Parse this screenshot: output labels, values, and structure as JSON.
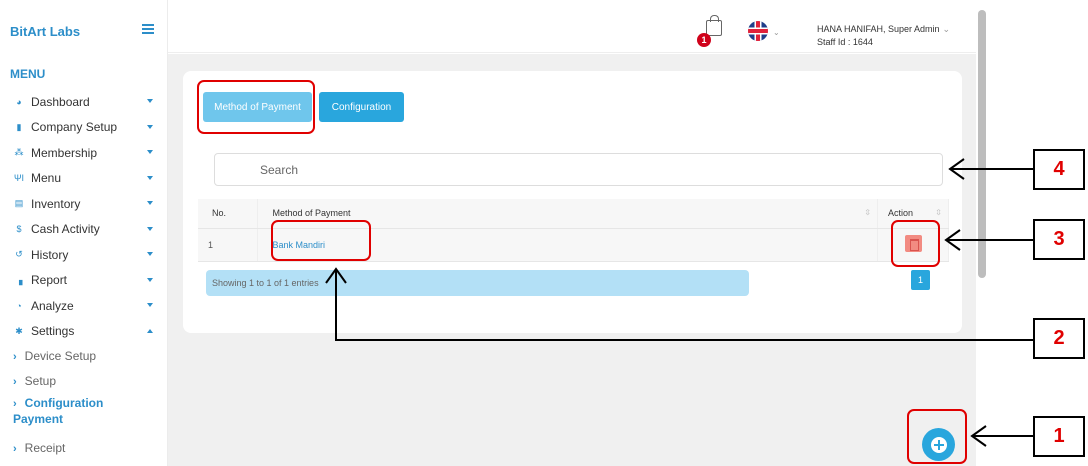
{
  "sidebar": {
    "brand": "BitArt Labs",
    "menu_title": "MENU",
    "items": [
      {
        "label": "Dashboard",
        "icon": "dashboard-icon",
        "glyph": "◕"
      },
      {
        "label": "Company Setup",
        "icon": "building-icon",
        "glyph": "▮"
      },
      {
        "label": "Membership",
        "icon": "users-icon",
        "glyph": "⁂"
      },
      {
        "label": "Menu",
        "icon": "utensils-icon",
        "glyph": "ΨΙ"
      },
      {
        "label": "Inventory",
        "icon": "inventory-icon",
        "glyph": "▤"
      },
      {
        "label": "Cash Activity",
        "icon": "dollar-icon",
        "glyph": "$"
      },
      {
        "label": "History",
        "icon": "history-icon",
        "glyph": "↺"
      },
      {
        "label": "Report",
        "icon": "file-icon",
        "glyph": "▗"
      },
      {
        "label": "Analyze",
        "icon": "pie-chart-icon",
        "glyph": "◔"
      },
      {
        "label": "Settings",
        "icon": "settings-gear-icon",
        "glyph": "✱"
      }
    ],
    "submenu": [
      {
        "label": "Device Setup"
      },
      {
        "label": "Setup"
      },
      {
        "label": "Configuration",
        "label2": "Payment"
      },
      {
        "label": "Receipt"
      }
    ]
  },
  "topbar": {
    "cart_badge": "1",
    "user_name": "HANA HANIFAH, Super Admin",
    "staff_id": "Staff Id : 1644"
  },
  "tabs": {
    "method_label": "Method of Payment",
    "config_label": "Configuration"
  },
  "search": {
    "placeholder": "Search"
  },
  "table": {
    "headers": {
      "no": "No.",
      "method": "Method of Payment",
      "action": "Action"
    },
    "rows": [
      {
        "no": "1",
        "method": "Bank Mandiri"
      }
    ]
  },
  "pagination": {
    "info": "Showing 1 to 1 of 1 entries",
    "page": "1"
  },
  "annotations": {
    "callouts": [
      "1",
      "2",
      "3",
      "4"
    ],
    "color": "#e00000"
  },
  "colors": {
    "accent": "#29a6dd",
    "accent_light": "#6fc6ec",
    "badge": "#d0021b"
  }
}
